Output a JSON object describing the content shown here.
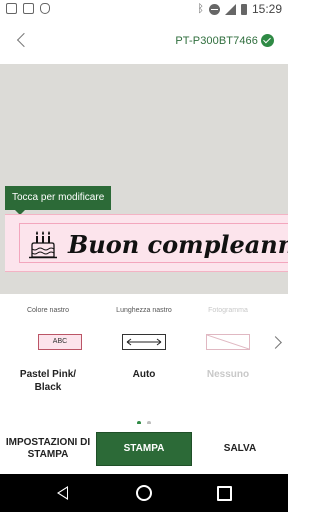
{
  "status_bar": {
    "time": "15:29",
    "left_icons": [
      "image-icon",
      "photo-icon",
      "shield-icon"
    ],
    "right_icons": [
      "bluetooth-icon",
      "do-not-disturb-icon",
      "signal-icon",
      "battery-icon"
    ]
  },
  "header": {
    "device_name": "PT-P300BT7466",
    "connected": true
  },
  "canvas": {
    "tooltip": "Tocca per modificare",
    "label_text": "Buon compleanno",
    "label_color": "#fce4ec"
  },
  "settings": {
    "columns": [
      {
        "title": "Colore nastro",
        "preview": "ABC",
        "value": "Pastel Pink/\nBlack",
        "enabled": true
      },
      {
        "title": "Lunghezza nastro",
        "value": "Auto",
        "enabled": true
      },
      {
        "title": "Fotogramma",
        "value": "Nessuno",
        "enabled": false
      }
    ],
    "page_count": 2,
    "active_page": 1
  },
  "actions": {
    "settings_label": "IMPOSTAZIONI DI STAMPA",
    "print_label": "STAMPA",
    "save_label": "SALVA"
  },
  "colors": {
    "accent": "#2c6a37",
    "canvas_bg": "#dcdbd7"
  }
}
